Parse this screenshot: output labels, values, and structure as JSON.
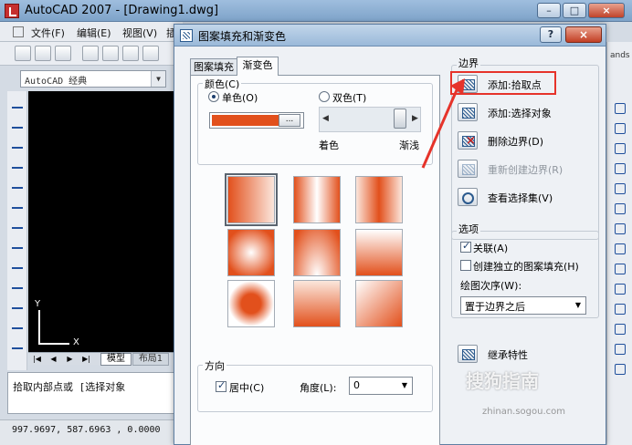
{
  "app": {
    "title": "AutoCAD 2007 - [Drawing1.dwg]",
    "menu": [
      "文件(F)",
      "编辑(E)",
      "视图(V)",
      "插"
    ],
    "workspace": "AutoCAD 经典",
    "model_tab": "模型",
    "layout_tab": "布局1",
    "command_prompt": "拾取内部点或 [选择对象",
    "coordinates": "997.9697,  587.6963 , 0.0000",
    "ucs_y": "Y",
    "ucs_x": "X",
    "right_edge_text": "ands"
  },
  "dialog": {
    "title": "图案填充和渐变色",
    "help_label": "?",
    "close_label": "×",
    "tabs": [
      "图案填充",
      "渐变色"
    ],
    "active_tab": "渐变色",
    "color_group": "颜色(C)",
    "single_color": "单色(O)",
    "two_color": "双色(T)",
    "shade_label": "着色",
    "tint_label": "渐浅",
    "swatch_color": "#e2501c",
    "dots_label": "...",
    "direction_group": "方向",
    "centered_label": "居中(C)",
    "centered_checked": true,
    "angle_label": "角度(L):",
    "angle_value": "0",
    "boundary_group": "边界",
    "boundary_buttons": [
      {
        "label": "添加:拾取点",
        "enabled": true
      },
      {
        "label": "添加:选择对象",
        "enabled": true
      },
      {
        "label": "删除边界(D)",
        "enabled": true
      },
      {
        "label": "重新创建边界(R)",
        "enabled": false
      },
      {
        "label": "查看选择集(V)",
        "enabled": true
      }
    ],
    "options_group": "选项",
    "associative_label": "关联(A)",
    "associative_checked": true,
    "independent_label": "创建独立的图案填充(H)",
    "independent_checked": false,
    "draw_order_label": "绘图次序(W):",
    "draw_order_value": "置于边界之后",
    "inherit_label": "继承特性"
  },
  "watermark": {
    "main": "搜狗指南",
    "sub": "zhinan.sogou.com"
  },
  "colors": {
    "accent": "#e2501c",
    "highlight": "#e6332a"
  }
}
